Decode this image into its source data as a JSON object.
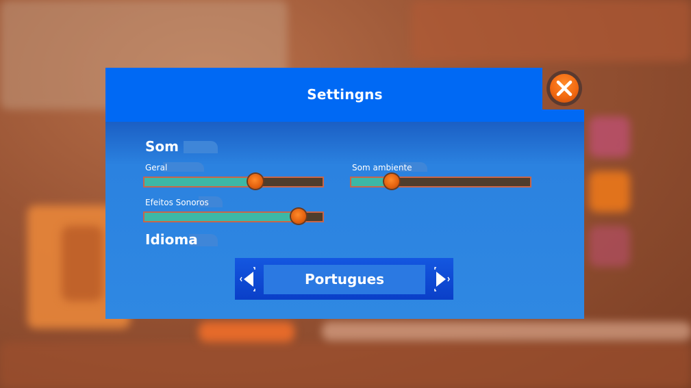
{
  "dialog": {
    "title": "Settingns",
    "close_icon": "close-icon"
  },
  "sections": {
    "sound": {
      "title": "Som",
      "sliders": [
        {
          "label": "Geral",
          "value": 0.62
        },
        {
          "label": "Som ambiente",
          "value": 0.23
        },
        {
          "label": "Efeitos Sonoros",
          "value": 0.86
        }
      ]
    },
    "language": {
      "title": "Idioma",
      "value": "Portugues",
      "prev_icon": "arrow-left-icon",
      "next_icon": "arrow-right-icon"
    }
  },
  "colors": {
    "header": "#0069f4",
    "slider_fill": "#3cb8a6",
    "slider_track": "#4f3d2b",
    "knob": "#f26a12"
  }
}
